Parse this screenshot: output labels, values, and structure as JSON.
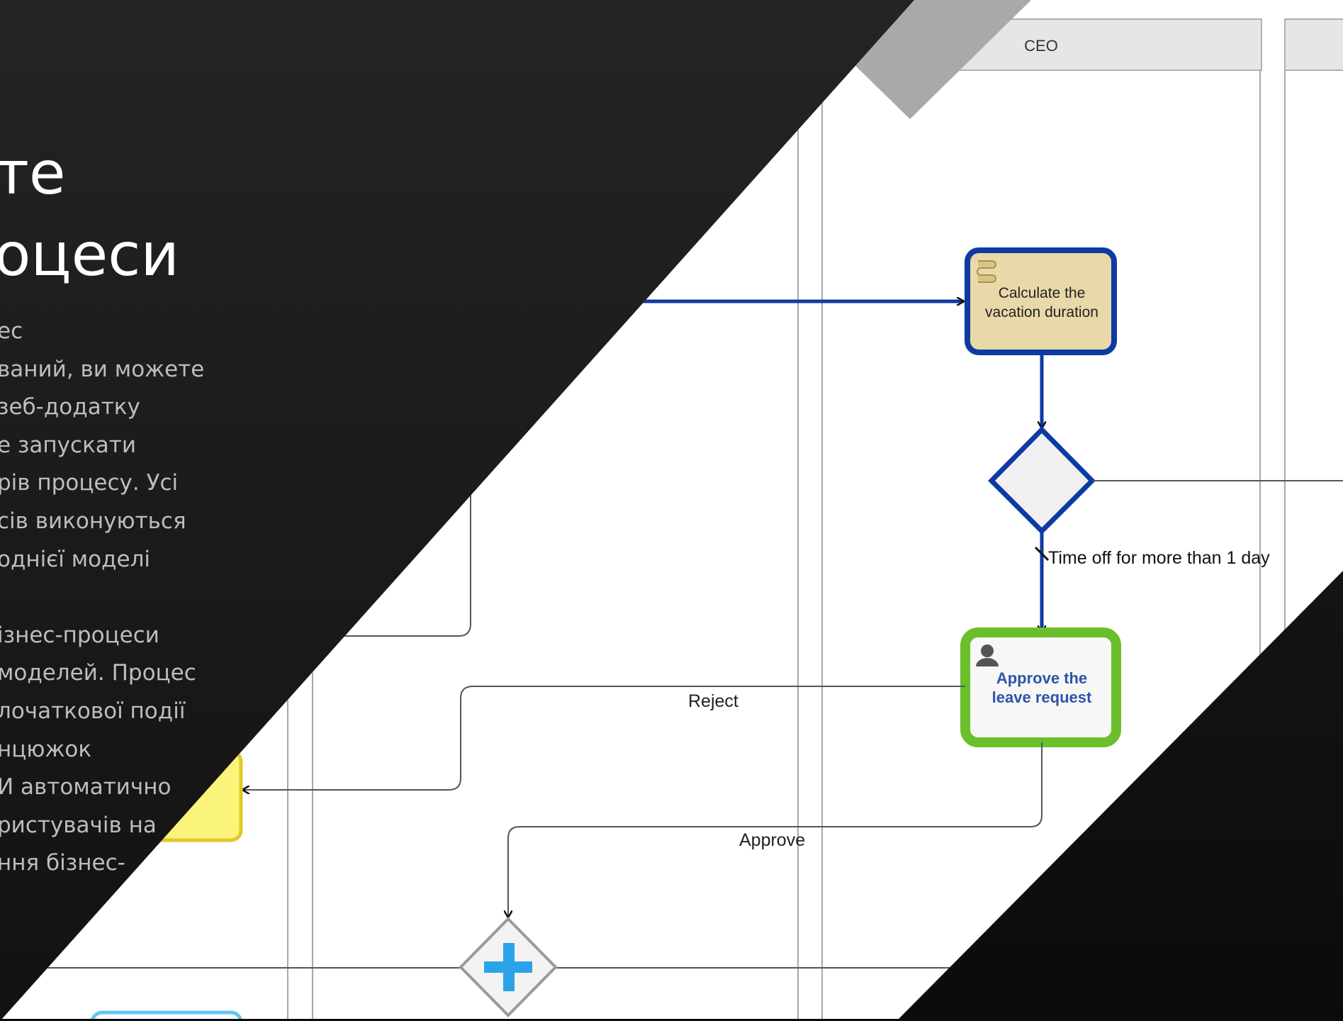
{
  "slide": {
    "title_lines": [
      "те",
      "оцеси"
    ],
    "body_lines": [
      "ес",
      "ваний, ви можете",
      "зеб-додатку",
      "е запускати",
      "рів процесу. Усі",
      "сів виконуються",
      "однієї моделі",
      "",
      "ізнес-процеси",
      " моделей. Процес",
      "лочаткової події",
      "нцюжок",
      "И автоматично",
      "ристувачів на",
      "ння бізнес-"
    ]
  },
  "diagram": {
    "lane_headers": [
      "CEO",
      ""
    ],
    "tasks": {
      "calculate": {
        "line1": "Calculate the",
        "line2": "vacation duration"
      },
      "approve": {
        "line1": "Approve the",
        "line2": "leave request"
      }
    },
    "flow_labels": {
      "time_off": "Time off for more than 1 day",
      "reject": "Reject",
      "approve": "Approve"
    }
  },
  "colors": {
    "dark_bg": "#141414",
    "diagram_bg": "#ffffff",
    "flow_blue": "#0d3aa3",
    "task_green": "#6bbf2c",
    "task_tan": "#e9d8a8",
    "gateway_plus": "#2aa3e8",
    "gray_triangle": "#a9a9a9"
  }
}
